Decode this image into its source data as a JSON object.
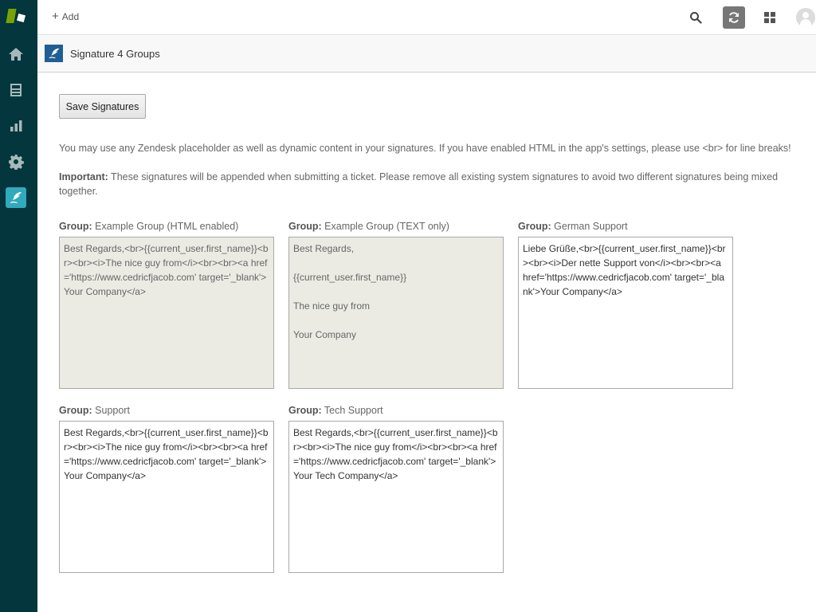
{
  "topbar": {
    "add_label": "Add",
    "icons": [
      "search-icon",
      "refresh-icon",
      "apps-grid-icon",
      "user-avatar-icon"
    ]
  },
  "sidebar": {
    "items": [
      {
        "name": "home",
        "icon": "home-icon"
      },
      {
        "name": "views",
        "icon": "inbox-icon"
      },
      {
        "name": "reporting",
        "icon": "bar-chart-icon"
      },
      {
        "name": "admin",
        "icon": "gear-icon"
      },
      {
        "name": "signature-app",
        "icon": "quill-icon",
        "active": true
      }
    ]
  },
  "app": {
    "title": "Signature 4 Groups"
  },
  "content": {
    "save_label": "Save Signatures",
    "info_text": "You may use any Zendesk placeholder as well as dynamic content in your signatures. If you have enabled HTML in the app's settings, please use <br> for line breaks!",
    "important_label": "Important:",
    "important_text": " These signatures will be appended when submitting a ticket. Please remove all existing system signatures to avoid two different signatures being mixed together.",
    "group_prefix": "Group:",
    "groups": [
      {
        "name": "Example Group (HTML enabled)",
        "signature": "Best Regards,<br>{{current_user.first_name}}<br><br><i>The nice guy from</i><br><br><a href='https://www.cedricfjacob.com' target='_blank'>Your Company</a>",
        "disabled": true
      },
      {
        "name": "Example Group (TEXT only)",
        "signature": "Best Regards,\n\n{{current_user.first_name}}\n\nThe nice guy from\n\nYour Company",
        "disabled": true
      },
      {
        "name": "German Support",
        "signature": "Liebe Grüße,<br>{{current_user.first_name}}<br><br><i>Der nette Support von</i><br><br><a href='https://www.cedricfjacob.com' target='_blank'>Your Company</a>",
        "disabled": false
      },
      {
        "name": "Support",
        "signature": "Best Regards,<br>{{current_user.first_name}}<br><br><i>The nice guy from</i><br><br><a href='https://www.cedricfjacob.com' target='_blank'>Your Company</a>",
        "disabled": false
      },
      {
        "name": "Tech Support",
        "signature": "Best Regards,<br>{{current_user.first_name}}<br><br><i>The nice guy from</i><br><br><a href='https://www.cedricfjacob.com' target='_blank'>Your Tech Company</a>",
        "disabled": false
      }
    ]
  },
  "colors": {
    "sidebar_bg": "#03363d",
    "active_nav": "#30aabc",
    "zendesk_green": "#78a300",
    "app_icon_bg": "#1f5f95",
    "disabled_textarea_bg": "#ebebe4"
  }
}
